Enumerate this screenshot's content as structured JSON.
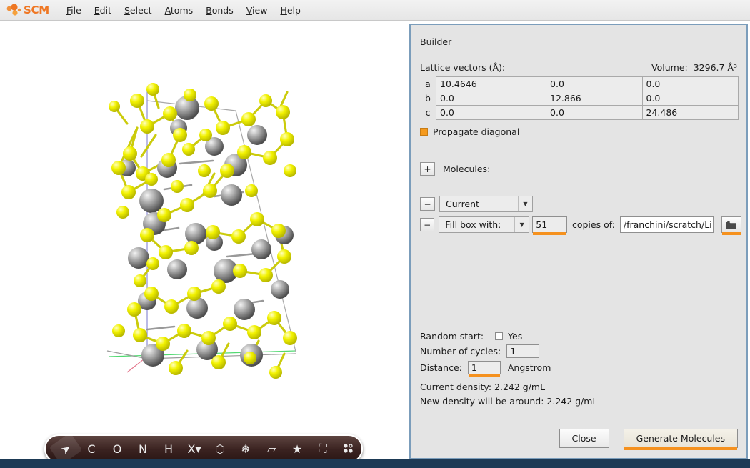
{
  "app": {
    "logo_text": "SCM",
    "logo_icon": "scm-molecule-logo"
  },
  "menubar": {
    "items": [
      {
        "label": "File",
        "mnemonic": "F"
      },
      {
        "label": "Edit",
        "mnemonic": "E"
      },
      {
        "label": "Select",
        "mnemonic": "S"
      },
      {
        "label": "Atoms",
        "mnemonic": "A"
      },
      {
        "label": "Bonds",
        "mnemonic": "B"
      },
      {
        "label": "View",
        "mnemonic": "V"
      },
      {
        "label": "Help",
        "mnemonic": "H"
      }
    ]
  },
  "atom_toolbar": {
    "buttons": [
      {
        "name": "select-cursor-tool",
        "glyph": "➤",
        "selected": true
      },
      {
        "name": "carbon-tool",
        "glyph": "C",
        "selected": false
      },
      {
        "name": "oxygen-tool",
        "glyph": "O",
        "selected": false
      },
      {
        "name": "nitrogen-tool",
        "glyph": "N",
        "selected": false
      },
      {
        "name": "hydrogen-tool",
        "glyph": "H",
        "selected": false
      },
      {
        "name": "other-element-tool",
        "glyph": "X▾",
        "selected": false
      },
      {
        "name": "ring-tool",
        "glyph": "⬡",
        "selected": false
      },
      {
        "name": "crystal-tool",
        "glyph": "❄",
        "selected": false
      },
      {
        "name": "plane-tool",
        "glyph": "▱",
        "selected": false
      }
    ],
    "right_buttons": [
      {
        "name": "favorite-star-tool",
        "glyph": "★"
      },
      {
        "name": "unit-cell-tool",
        "glyph": "⛶"
      },
      {
        "name": "atom-dots-tool",
        "glyph": "∷"
      }
    ]
  },
  "builder": {
    "title": "Builder",
    "lattice_label": "Lattice vectors (Å):",
    "volume_label": "Volume:",
    "volume_value": "3296.7 Å³",
    "lattice": {
      "rows": [
        {
          "name": "a",
          "x": "10.4646",
          "y": "0.0",
          "z": "0.0"
        },
        {
          "name": "b",
          "x": "0.0",
          "y": "12.866",
          "z": "0.0"
        },
        {
          "name": "c",
          "x": "0.0",
          "y": "0.0",
          "z": "24.486"
        }
      ]
    },
    "propagate": {
      "label": "Propagate diagonal",
      "checked": true
    },
    "molecules": {
      "add_button": "+",
      "label": "Molecules:",
      "rows": [
        {
          "remove_button": "−",
          "mode": "Current"
        },
        {
          "remove_button": "−",
          "mode": "Fill box with:",
          "count": "51",
          "copies_label": "copies of:",
          "path": "/franchini/scratch/Li",
          "browse_icon": "folder-icon"
        }
      ]
    },
    "settings": {
      "random_start_label": "Random start:",
      "random_start_yes": "Yes",
      "random_start_checked": false,
      "cycles_label": "Number of cycles:",
      "cycles_value": "1",
      "distance_label": "Distance:",
      "distance_value": "1",
      "distance_unit": "Angstrom"
    },
    "density": {
      "current": "Current density: 2.242 g/mL",
      "new": "New density will be around: 2.242 g/mL"
    },
    "buttons": {
      "close": "Close",
      "generate": "Generate Molecules"
    }
  },
  "colors": {
    "accent_orange": "#f5911e",
    "brand_orange": "#ef7622",
    "panel_border": "#7b9dbb",
    "statusbar": "#1d3a55",
    "atom_sulfur": "#e8e800",
    "atom_metal": "#9a9a9a"
  }
}
